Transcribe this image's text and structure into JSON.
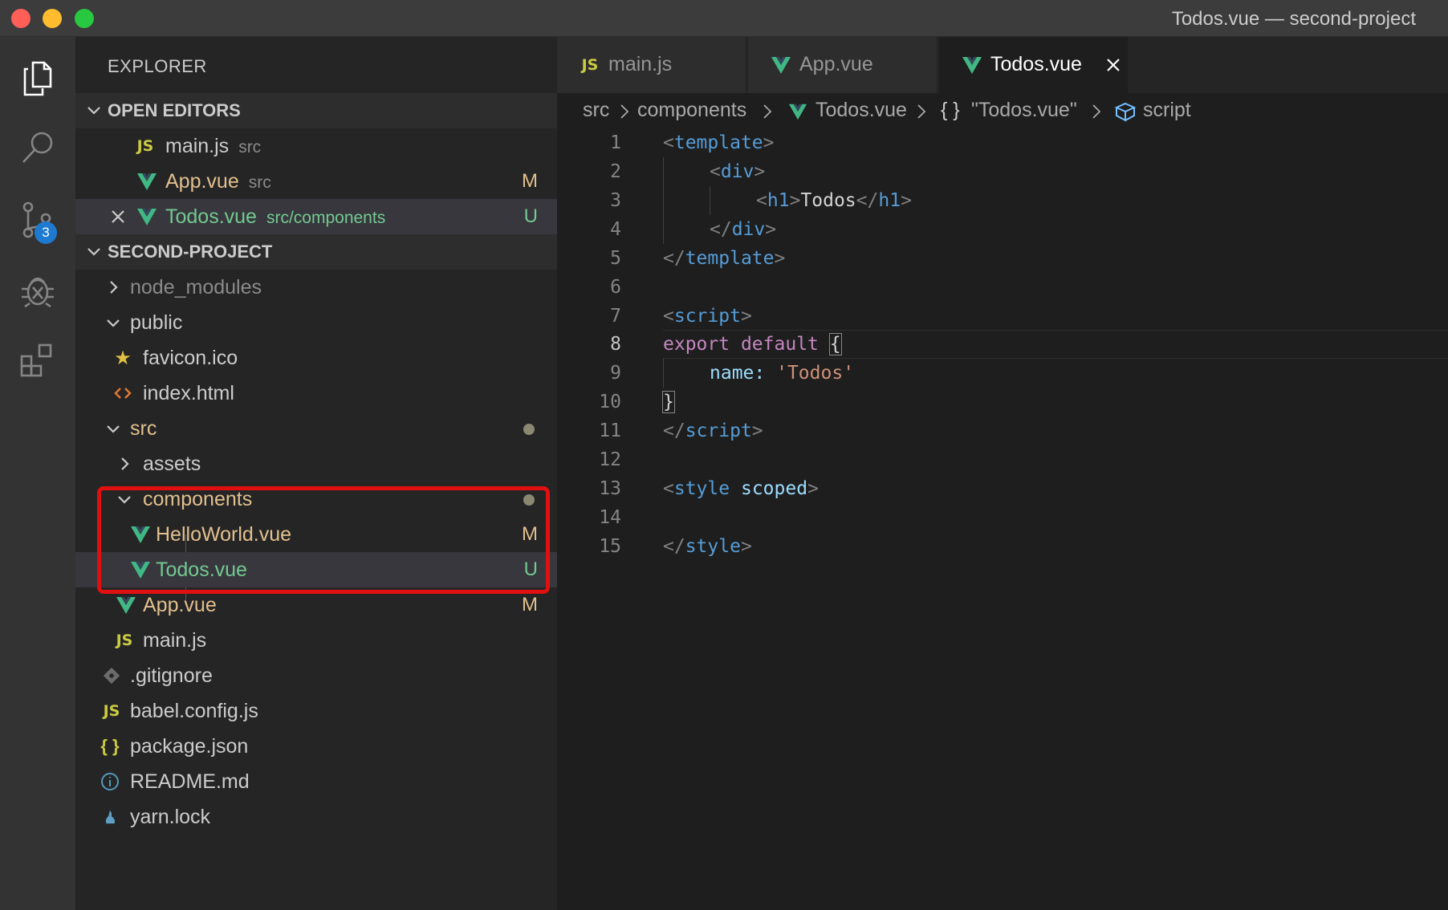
{
  "window": {
    "title": "Todos.vue — second-project"
  },
  "activity_bar": {
    "items": [
      {
        "name": "explorer",
        "icon": "files-icon"
      },
      {
        "name": "search",
        "icon": "search-icon"
      },
      {
        "name": "source-control",
        "icon": "source-control-icon",
        "badge": "3"
      },
      {
        "name": "debug",
        "icon": "debug-icon"
      },
      {
        "name": "extensions",
        "icon": "extensions-icon"
      }
    ]
  },
  "sidebar": {
    "title": "EXPLORER",
    "open_editors": {
      "header": "OPEN EDITORS",
      "items": [
        {
          "icon": "JS",
          "label": "main.js",
          "path": "src",
          "status": ""
        },
        {
          "icon": "vue",
          "label": "App.vue",
          "path": "src",
          "status": "M"
        },
        {
          "icon": "vue",
          "label": "Todos.vue",
          "path": "src/components",
          "status": "U"
        }
      ]
    },
    "project": {
      "header": "SECOND-PROJECT",
      "items": [
        {
          "label": "node_modules",
          "type": "folder",
          "expanded": false
        },
        {
          "label": "public",
          "type": "folder",
          "expanded": true
        },
        {
          "label": "favicon.ico",
          "type": "file",
          "icon": "star"
        },
        {
          "label": "index.html",
          "type": "file",
          "icon": "html"
        },
        {
          "label": "src",
          "type": "folder",
          "expanded": true
        },
        {
          "label": "assets",
          "type": "folder",
          "expanded": false
        },
        {
          "label": "components",
          "type": "folder",
          "expanded": true
        },
        {
          "label": "HelloWorld.vue",
          "type": "file",
          "icon": "vue",
          "status": "M"
        },
        {
          "label": "Todos.vue",
          "type": "file",
          "icon": "vue",
          "status": "U"
        },
        {
          "label": "App.vue",
          "type": "file",
          "icon": "vue",
          "status": "M"
        },
        {
          "label": "main.js",
          "type": "file",
          "icon": "JS"
        },
        {
          "label": ".gitignore",
          "type": "file",
          "icon": "git"
        },
        {
          "label": "babel.config.js",
          "type": "file",
          "icon": "JS"
        },
        {
          "label": "package.json",
          "type": "file",
          "icon": "{ }"
        },
        {
          "label": "README.md",
          "type": "file",
          "icon": "info"
        },
        {
          "label": "yarn.lock",
          "type": "file",
          "icon": "yarn"
        }
      ]
    }
  },
  "tabs": [
    {
      "icon": "JS",
      "label": "main.js",
      "active": false
    },
    {
      "icon": "vue",
      "label": "App.vue",
      "active": false
    },
    {
      "icon": "vue",
      "label": "Todos.vue",
      "active": true
    }
  ],
  "breadcrumbs": [
    "src",
    "components",
    "Todos.vue",
    "\"Todos.vue\"",
    "script"
  ],
  "breadcrumb_symbols": {
    "object": "{ }"
  },
  "editor": {
    "current_line": 8,
    "line_numbers": [
      "1",
      "2",
      "3",
      "4",
      "5",
      "6",
      "7",
      "8",
      "9",
      "10",
      "11",
      "12",
      "13",
      "14",
      "15"
    ],
    "tokens": {
      "l1": [
        "<",
        "template",
        ">"
      ],
      "l2": [
        "<",
        "div",
        ">"
      ],
      "l3": [
        "<",
        "h1",
        ">",
        "Todos",
        "</",
        "h1",
        ">"
      ],
      "l4": [
        "</",
        "div",
        ">"
      ],
      "l5": [
        "</",
        "template",
        ">"
      ],
      "l7": [
        "<",
        "script",
        ">"
      ],
      "l8": [
        "export",
        "default",
        "{"
      ],
      "l9": [
        "name:",
        "'Todos'"
      ],
      "l10": [
        "}"
      ],
      "l11": [
        "</",
        "script",
        ">"
      ],
      "l13": [
        "<",
        "style",
        "scoped",
        ">"
      ],
      "l15": [
        "</",
        "style",
        ">"
      ]
    }
  },
  "colors": {
    "vue_green": "#41b883",
    "modified": "#e2c08d",
    "untracked": "#73c991",
    "highlight_box": "#e01010",
    "badge": "#1e7ad1"
  }
}
